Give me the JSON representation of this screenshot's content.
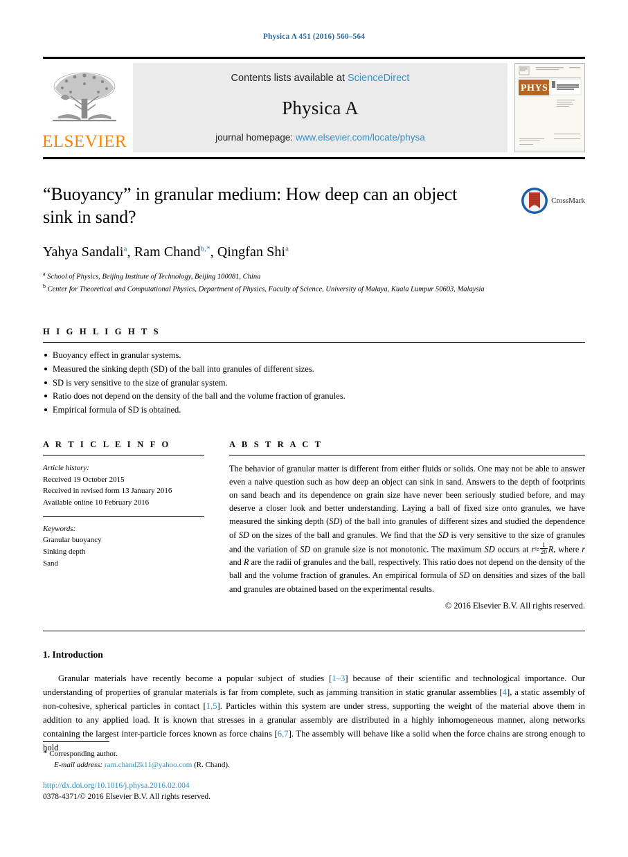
{
  "running_head": "Physica A 451 (2016) 560–564",
  "masthead": {
    "contents_prefix": "Contents lists available at",
    "contents_link": "ScienceDirect",
    "journal_title": "Physica A",
    "homepage_prefix": "journal homepage:",
    "homepage_link": "www.elsevier.com/locate/physa",
    "publisher_wordmark": "ELSEVIER",
    "cover_banner_text": "PHYSICA",
    "cover_subtitle": "STATISTICAL MECHANICS AND ITS APPLICATIONS"
  },
  "title_block": {
    "title": "“Buoyancy” in granular medium: How deep can an object sink in sand?",
    "authors": [
      {
        "name": "Yahya Sandali",
        "sup": "a",
        "sep": ", "
      },
      {
        "name": "Ram Chand",
        "sup": "b,*",
        "sep": ", "
      },
      {
        "name": "Qingfan Shi",
        "sup": "a",
        "sep": ""
      }
    ],
    "affiliations": [
      {
        "marker": "a",
        "text": "School of Physics, Beijing Institute of Technology, Beijing 100081, China"
      },
      {
        "marker": "b",
        "text": "Center for Theoretical and Computational Physics, Department of Physics, Faculty of Science, University of Malaya, Kuala Lumpur 50603, Malaysia"
      }
    ],
    "crossmark_label": "CrossMark"
  },
  "highlights": {
    "heading": "H I G H L I G H T S",
    "items": [
      "Buoyancy effect in granular systems.",
      "Measured the sinking depth (SD) of the ball into granules of different sizes.",
      "SD is very sensitive to the size of granular system.",
      "Ratio does not depend on the density of the ball and the volume fraction of granules.",
      "Empirical formula of SD is obtained."
    ]
  },
  "article_info": {
    "heading": "A R T I C L E    I N F O",
    "history_label": "Article history:",
    "history": [
      "Received 19 October 2015",
      "Received in revised form 13 January 2016",
      "Available online 10 February 2016"
    ],
    "keywords_label": "Keywords:",
    "keywords": [
      "Granular buoyancy",
      "Sinking depth",
      "Sand"
    ]
  },
  "abstract": {
    "heading": "A B S T R A C T",
    "part1": "The behavior of granular matter is different from either fluids or solids. One may not be able to answer even a naive question such as how deep an object can sink in sand. Answers to the depth of footprints on sand beach and its dependence on grain size have never been seriously studied before, and may deserve a closer look and better understanding. Laying a ball of fixed size onto granules, we have measured the sinking depth (",
    "sd1": "SD",
    "part2": ") of the ball into granules of different sizes and studied the dependence of ",
    "sd2": "SD",
    "part3": " on the sizes of the ball and granules. We find that the ",
    "sd3": "SD",
    "part4": " is very sensitive to the size of granules and the variation of ",
    "sd4": "SD",
    "part5": " on granule size is not monotonic. The maximum ",
    "sd5": "SD",
    "part6": " occurs at ",
    "var_r": "r",
    "approx": "≈",
    "frac_num": "1",
    "frac_den": "20",
    "var_R": "R",
    "part7": ", where ",
    "var_r2": "r",
    "part8": " and ",
    "var_R2": "R",
    "part9": " are the radii of granules and the ball, respectively. This ratio does not depend on the density of the ball and the volume fraction of granules. An empirical formula of ",
    "sd6": "SD",
    "part10": " on densities and sizes of the ball and granules are obtained based on the experimental results.",
    "copyright": "© 2016 Elsevier B.V. All rights reserved."
  },
  "introduction": {
    "heading": "1. Introduction",
    "p1_a": "Granular materials have recently become a popular subject of studies [",
    "cite1": "1–3",
    "p1_b": "] because of their scientific and technological importance. Our understanding of properties of granular materials is far from complete, such as jamming transition in static granular assemblies [",
    "cite2": "4",
    "p1_c": "], a static assembly of non-cohesive, spherical particles in contact [",
    "cite3": "1,5",
    "p1_d": "]. Particles within this system are under stress, supporting the weight of the material above them in addition to any applied load. It is known that stresses in a granular assembly are distributed in a highly inhomogeneous manner, along networks containing the largest inter-particle forces known as force chains [",
    "cite4": "6,7",
    "p1_e": "]. The assembly will behave like a solid when the force chains are strong enough to hold"
  },
  "footer": {
    "star": "*",
    "corresponding": "Corresponding author.",
    "email_label": "E-mail address:",
    "email": "ram.chand2k11@yahoo.com",
    "email_owner": "(R. Chand).",
    "doi": "http://dx.doi.org/10.1016/j.physa.2016.02.004",
    "issn_line": "0378-4371/© 2016 Elsevier B.V. All rights reserved."
  },
  "colors": {
    "link_blue": "#3b8fc4",
    "cite_blue": "#2b8fc4",
    "elsevier_orange": "#ff8200",
    "banner_gray": "#ebebeb",
    "crossmark_blue": "#1a5fa8",
    "crossmark_red": "#c0392b"
  }
}
